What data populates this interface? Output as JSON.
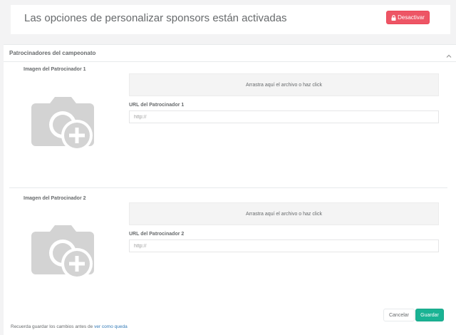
{
  "banner": {
    "message": "Las opciones de personalizar sponsors están activadas",
    "deactivate_label": "Desactivar",
    "deactivate_icon": "lock-icon"
  },
  "panel": {
    "title": "Patrocinadores del campeonato",
    "collapse_icon": "chevron-up-icon"
  },
  "sponsors": [
    {
      "image_label": "Imagen del Patrocinador 1",
      "dropzone_text": "Arrastra aquí el archivo o haz click",
      "url_label": "URL del Patrocinador 1",
      "url_placeholder": "http://",
      "url_value": "",
      "image_icon": "add-photo-icon"
    },
    {
      "image_label": "Imagen del Patrocinador 2",
      "dropzone_text": "Arrastra aquí el archivo o haz click",
      "url_label": "URL del Patrocinador 2",
      "url_placeholder": "http://",
      "url_value": "",
      "image_icon": "add-photo-icon"
    }
  ],
  "actions": {
    "cancel_label": "Cancelar",
    "save_label": "Guardar"
  },
  "footer": {
    "note_prefix": "Recuerda guardar los cambios antes de",
    "link_text": "ver como queda"
  },
  "colors": {
    "danger": "#ed5565",
    "primary": "#1ab394",
    "link": "#337ab7",
    "placeholder_icon": "#d3d3d3"
  }
}
